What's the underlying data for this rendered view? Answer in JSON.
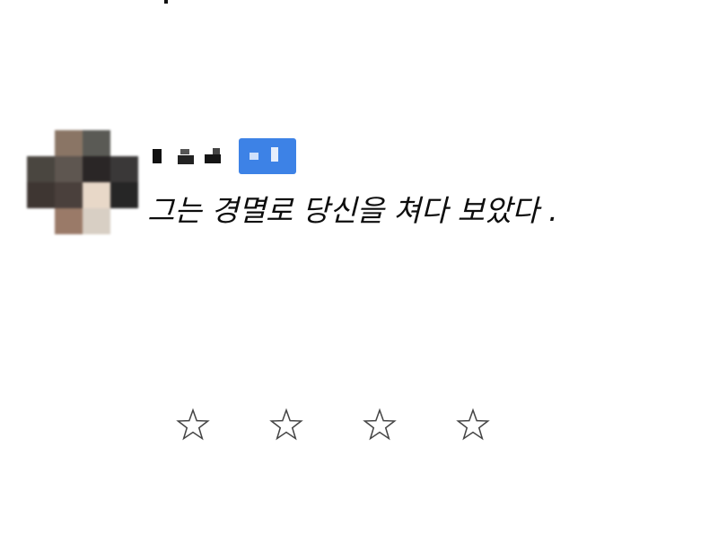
{
  "comment": {
    "text": "그는 경멸로 당신을 쳐다 보았다 ."
  },
  "rating": {
    "max_stars": 4,
    "filled": 0,
    "star_icon": "star-outline-icon"
  },
  "colors": {
    "badge_blue": "#3d82e6",
    "text": "#0d0d0d",
    "star_stroke": "#444444"
  }
}
